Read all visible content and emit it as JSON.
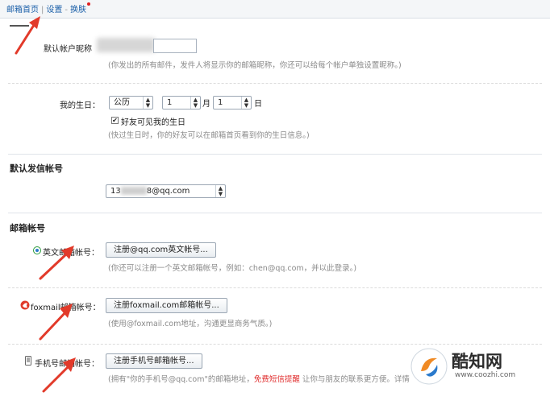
{
  "topnav": {
    "home": "邮箱首页",
    "sep": "|",
    "settings": "设置",
    "dash": "-",
    "skin": "换肤"
  },
  "nickname": {
    "label": "默认帐户昵称",
    "hint": "(你发出的所有邮件，发件人将显示你的邮箱昵称，你还可以给每个帐户单独设置昵称。)"
  },
  "birthday": {
    "label": "我的生日：",
    "calendar": "公历",
    "month": "1",
    "month_unit": "月",
    "day": "1",
    "day_unit": "日",
    "checkbox_label": "好友可见我的生日",
    "checkbox_checked": true,
    "hint": "(快过生日时，你的好友可以在邮箱首页看到你的生日信息。)"
  },
  "default_sender": {
    "title": "默认发信帐号",
    "account_prefix": "13",
    "account_suffix": "8@qq.com"
  },
  "mailbox_accounts": {
    "title": "邮箱帐号",
    "english": {
      "label": "英文邮箱帐号：",
      "button": "注册@qq.com英文帐号...",
      "hint": "(你还可以注册一个英文邮箱帐号，例如：chen@qq.com，并以此登录。)"
    },
    "foxmail": {
      "label": "foxmail邮箱帐号：",
      "button": "注册foxmail.com邮箱帐号...",
      "hint": "(使用@foxmail.com地址，沟通更显商务气质。)"
    },
    "mobile": {
      "label": "手机号邮箱帐号：",
      "button": "注册手机号邮箱帐号...",
      "hint_pre": "(拥有\"你的手机号@qq.com\"的邮箱地址，",
      "hint_red": "免费短信提醒",
      "hint_post": " 让你与朋友的联系更方便。详情"
    }
  },
  "watermark": {
    "name": "酷知网",
    "url": "www.coozhi.com"
  },
  "colors": {
    "link": "#1a5fa8",
    "arrow": "#e23a2a",
    "red_text": "#e03030"
  }
}
